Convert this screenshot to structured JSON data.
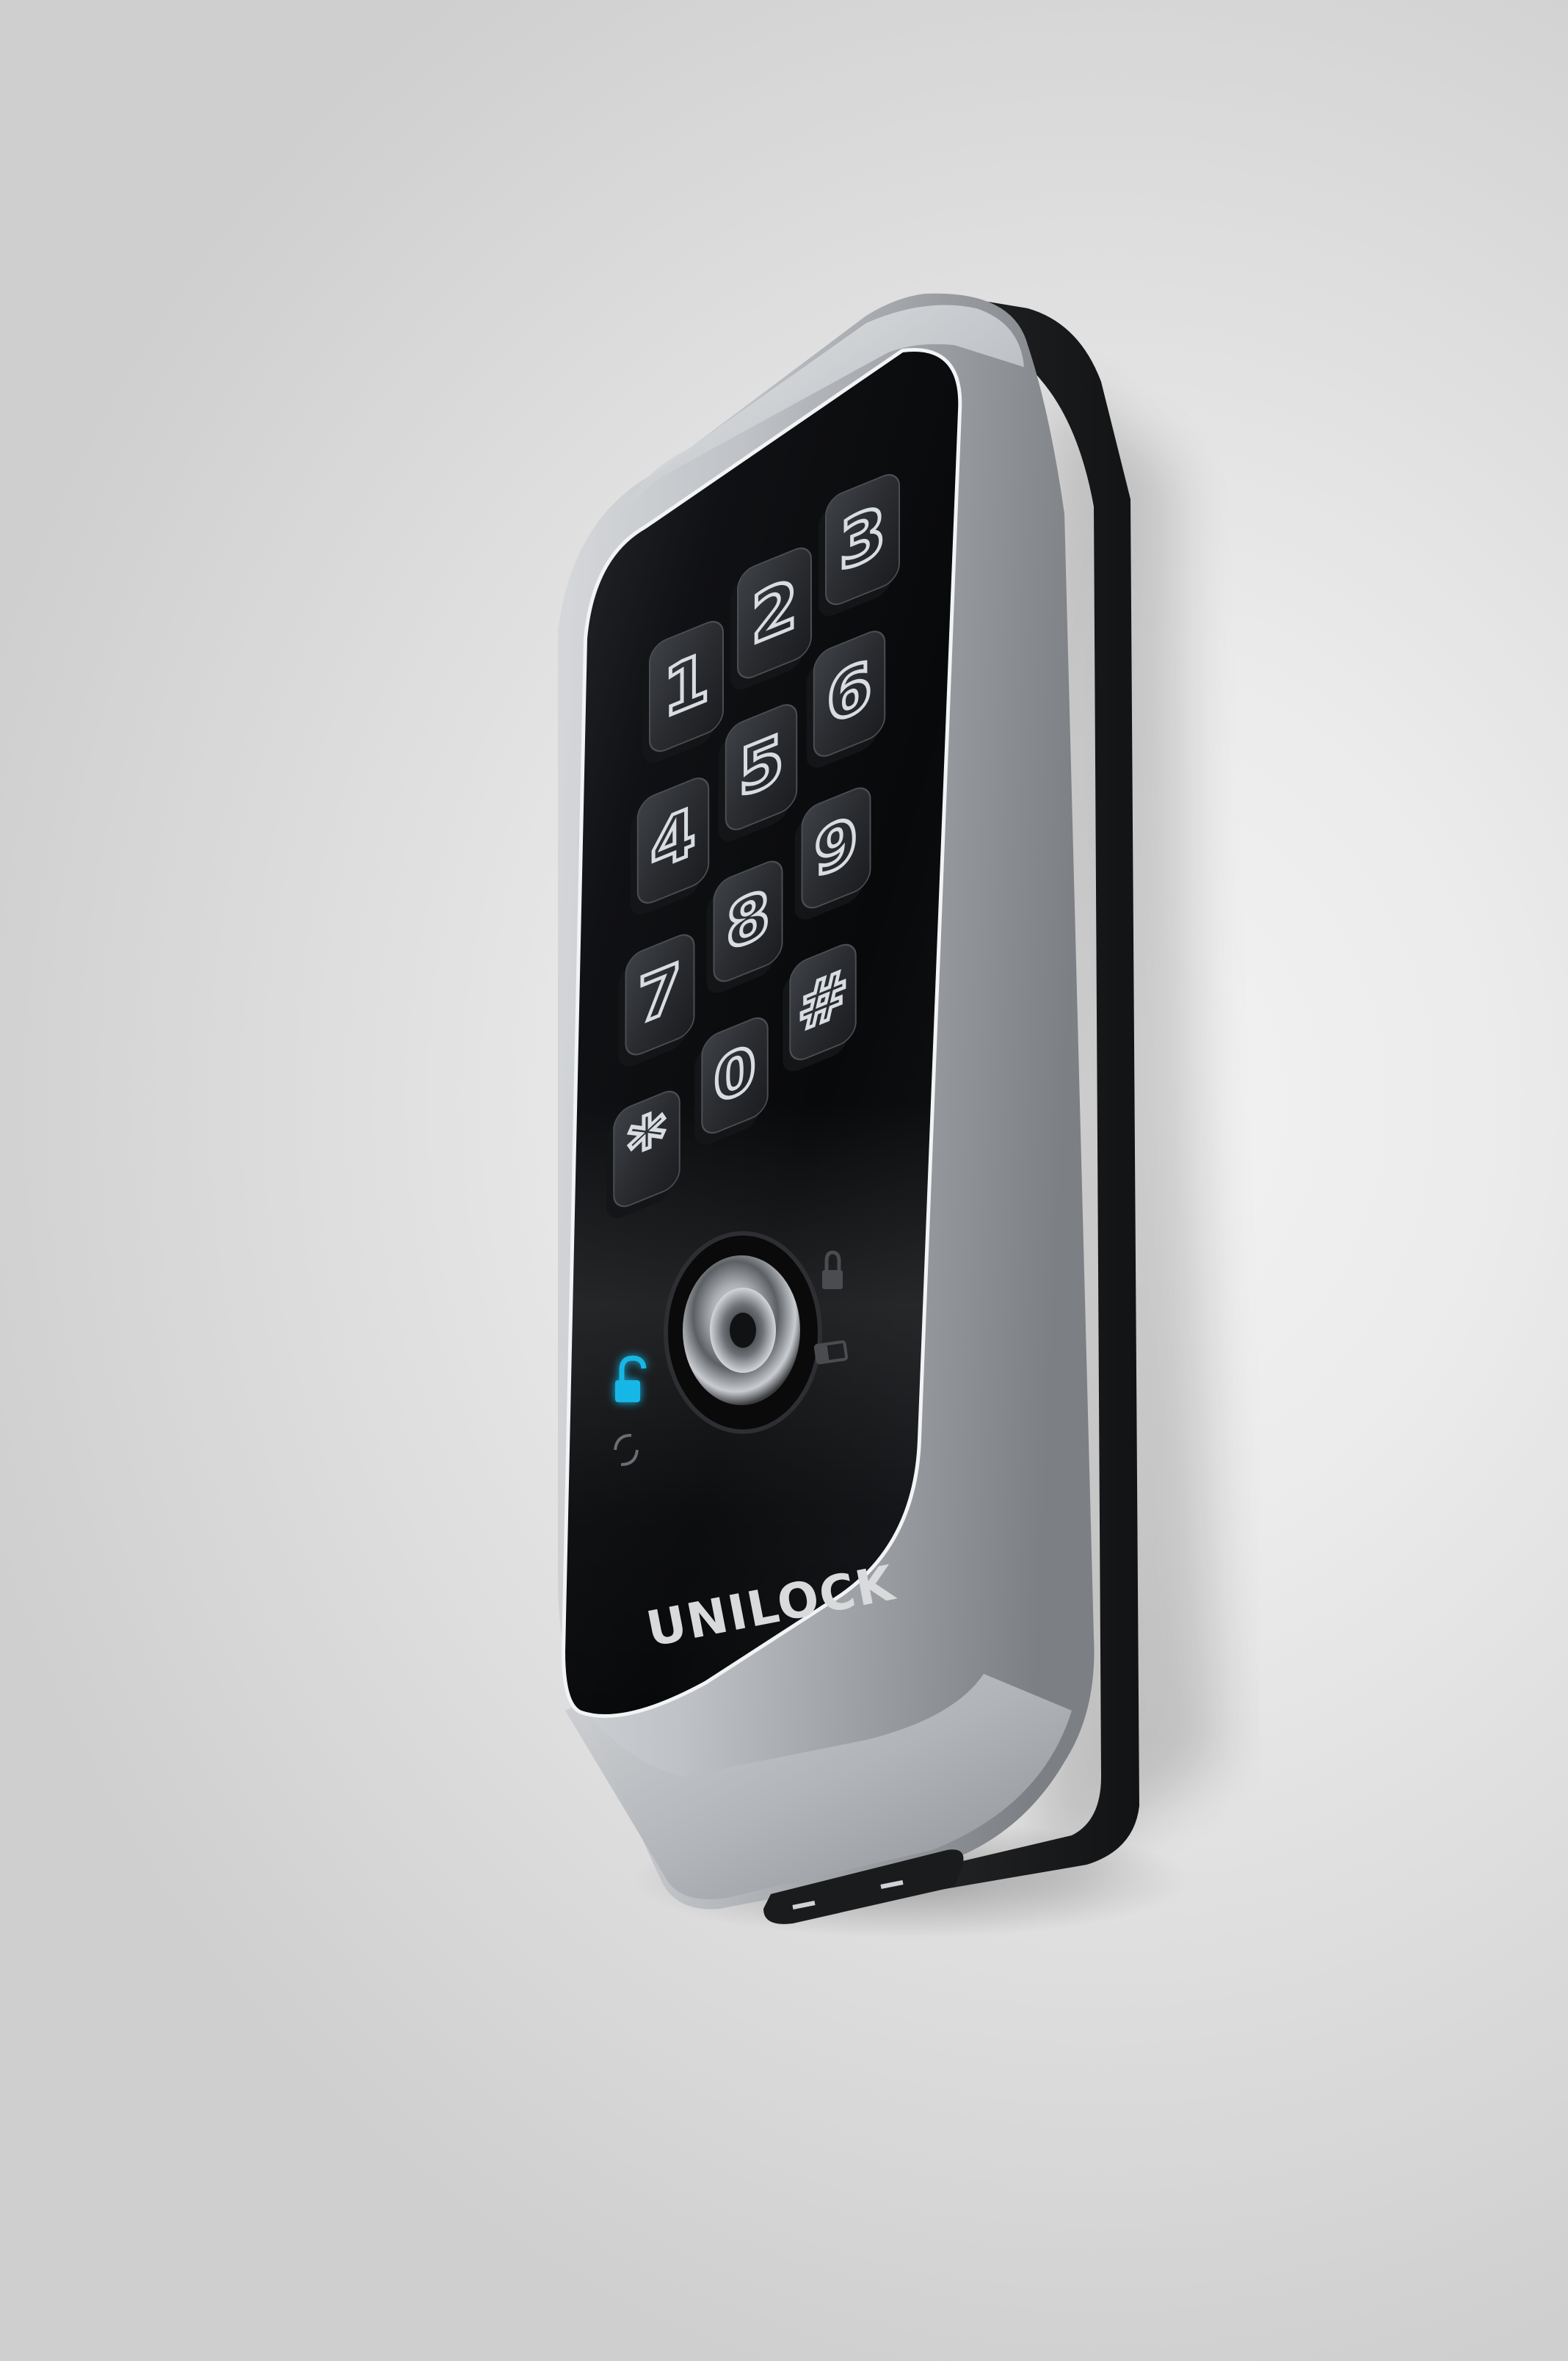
{
  "product": {
    "brand": "UNILOCK",
    "colors": {
      "body_silver": "#b9bcc0",
      "face_black": "#0c0d0f",
      "key_dark": "#2a2c30",
      "glyph_white": "#d8dde2",
      "indicator_blue": "#19b7e6",
      "background": "#e6e6e6"
    },
    "keypad": {
      "keys": [
        {
          "label": "1",
          "name": "key-1"
        },
        {
          "label": "2",
          "name": "key-2"
        },
        {
          "label": "3",
          "name": "key-3"
        },
        {
          "label": "4",
          "name": "key-4"
        },
        {
          "label": "5",
          "name": "key-5"
        },
        {
          "label": "6",
          "name": "key-6"
        },
        {
          "label": "7",
          "name": "key-7"
        },
        {
          "label": "8",
          "name": "key-8"
        },
        {
          "label": "9",
          "name": "key-9"
        },
        {
          "label": "*",
          "name": "key-star"
        },
        {
          "label": "0",
          "name": "key-0"
        },
        {
          "label": "#",
          "name": "key-hash"
        }
      ]
    },
    "icons": {
      "unlock": "unlock-icon",
      "lock": "lock-icon",
      "battery": "battery-icon",
      "sync": "sync-icon",
      "knob": "key-cylinder-icon"
    }
  }
}
